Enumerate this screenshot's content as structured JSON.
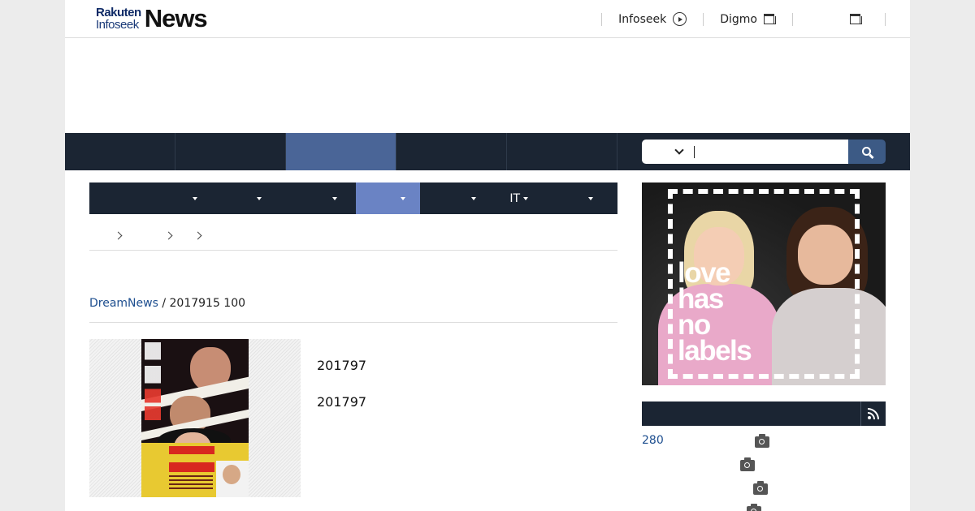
{
  "header": {
    "logo_brand": "Rakuten",
    "logo_sub": "Infoseek",
    "logo_title": "News",
    "links": [
      {
        "label": "Infoseek",
        "icon": "play-circle-icon"
      },
      {
        "label": "Digmo",
        "icon": "external-window-icon"
      },
      {
        "label": "",
        "icon": "external-window-icon"
      }
    ]
  },
  "search": {
    "input_value": "",
    "input_placeholder": ""
  },
  "categories": [
    {
      "label": ""
    },
    {
      "label": ""
    },
    {
      "label": ""
    },
    {
      "label": ""
    },
    {
      "label": ""
    },
    {
      "label": "IT"
    },
    {
      "label": ""
    }
  ],
  "article": {
    "source": "DreamNews",
    "date_line": " / 2017915 100",
    "lines": [
      "201797",
      "201797"
    ]
  },
  "ad": {
    "text": "love\nhas\nno\nlabels"
  },
  "ranking": {
    "items": [
      {
        "label": "280"
      },
      {
        "label": ""
      },
      {
        "label": ""
      },
      {
        "label": ""
      }
    ]
  }
}
